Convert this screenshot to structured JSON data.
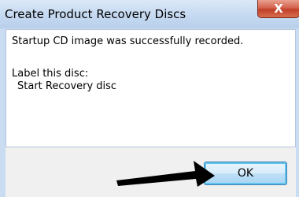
{
  "window": {
    "title": "Create Product Recovery Discs",
    "close_symbol": "X"
  },
  "dialog": {
    "message": "Startup CD image was successfully recorded.",
    "label_heading": "Label this disc:",
    "label_value": "Start Recovery disc"
  },
  "buttons": {
    "ok_label": "OK"
  },
  "icons": {
    "close": "close-icon",
    "annotation": "arrow-icon"
  },
  "colors": {
    "titlebar": "#c5d9f1",
    "close_button": "#c0402a",
    "ok_border": "#3c7fb1",
    "arrow": "#000000"
  }
}
